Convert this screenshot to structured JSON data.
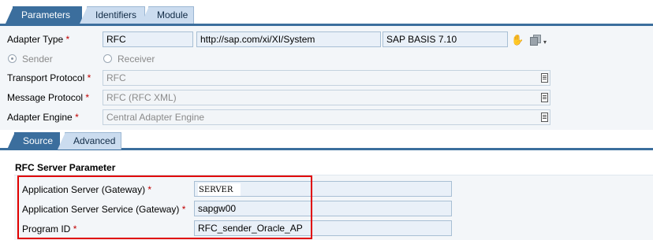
{
  "tabs": {
    "main": [
      {
        "label": "Parameters",
        "active": true
      },
      {
        "label": "Identifiers",
        "active": false
      },
      {
        "label": "Module",
        "active": false
      }
    ],
    "sub": [
      {
        "label": "Source",
        "active": true
      },
      {
        "label": "Advanced",
        "active": false
      }
    ]
  },
  "adapter": {
    "type_label": "Adapter Type",
    "type_value": "RFC",
    "namespace_value": "http://sap.com/xi/XI/System",
    "swcv_value": "SAP BASIS 7.10",
    "sender_label": "Sender",
    "receiver_label": "Receiver",
    "direction_selected": "Sender",
    "transport_label": "Transport Protocol",
    "transport_value": "RFC",
    "message_label": "Message Protocol",
    "message_value": "RFC (RFC XML)",
    "engine_label": "Adapter Engine",
    "engine_value": "Central Adapter Engine",
    "required_marker": "*"
  },
  "rfc": {
    "section_title": "RFC Server Parameter",
    "app_server_label": "Application Server (Gateway)",
    "app_server_value": "SERVER",
    "app_service_label": "Application Server Service (Gateway)",
    "app_service_value": "sapgw00",
    "program_id_label": "Program ID",
    "program_id_value": "RFC_sender_Oracle_AP"
  },
  "icons": {
    "hand": "hand-pointer-icon",
    "copy": "copy-icon",
    "dropdown": "dropdown-list-icon"
  },
  "colors": {
    "tab_active": "#3b6e9d",
    "tab_inactive": "#cbdcef",
    "required": "#c00000",
    "highlight_box": "#e00000"
  }
}
